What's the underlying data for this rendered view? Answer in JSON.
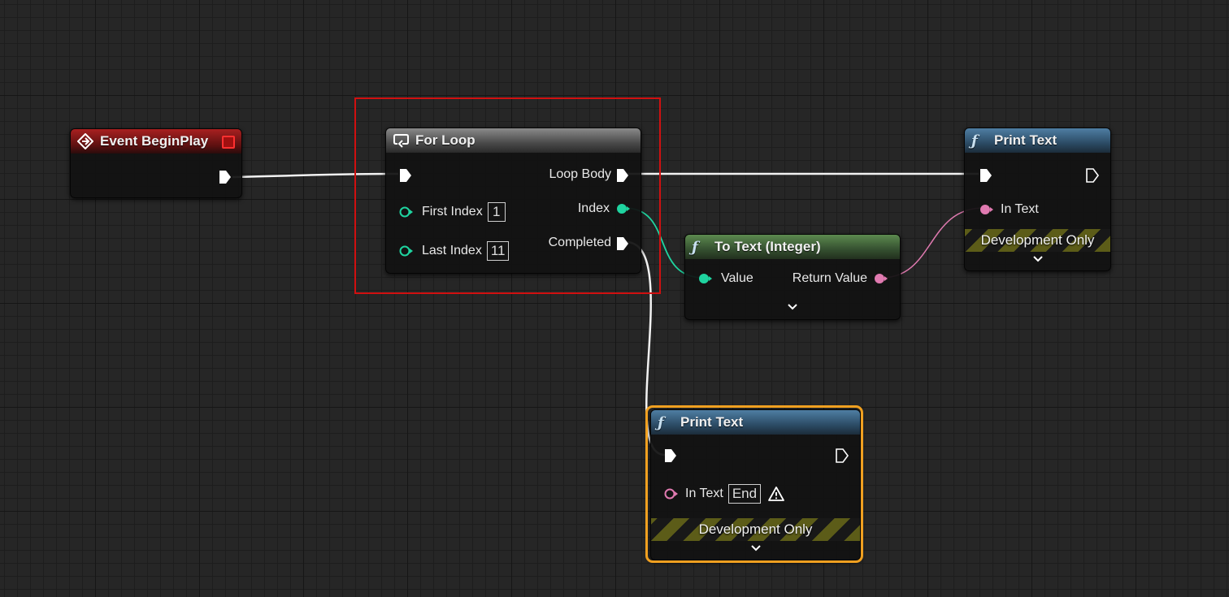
{
  "nodes": {
    "event_begin_play": {
      "title": "Event BeginPlay"
    },
    "for_loop": {
      "title": "For Loop",
      "first_index_label": "First Index",
      "first_index_value": "1",
      "last_index_label": "Last Index",
      "last_index_value": "11",
      "loop_body_label": "Loop Body",
      "index_label": "Index",
      "completed_label": "Completed"
    },
    "to_text": {
      "title": "To Text (Integer)",
      "value_label": "Value",
      "return_label": "Return Value"
    },
    "print_text_top": {
      "title": "Print Text",
      "in_text_label": "In Text",
      "dev_only": "Development Only"
    },
    "print_text_bottom": {
      "title": "Print Text",
      "in_text_label": "In Text",
      "in_text_value": "End",
      "dev_only": "Development Only"
    }
  },
  "colors": {
    "exec": "#ffffff",
    "integer": "#1fd4a0",
    "text": "#e07ab0",
    "selection": "#d01010",
    "node_selected": "#f0a020"
  }
}
